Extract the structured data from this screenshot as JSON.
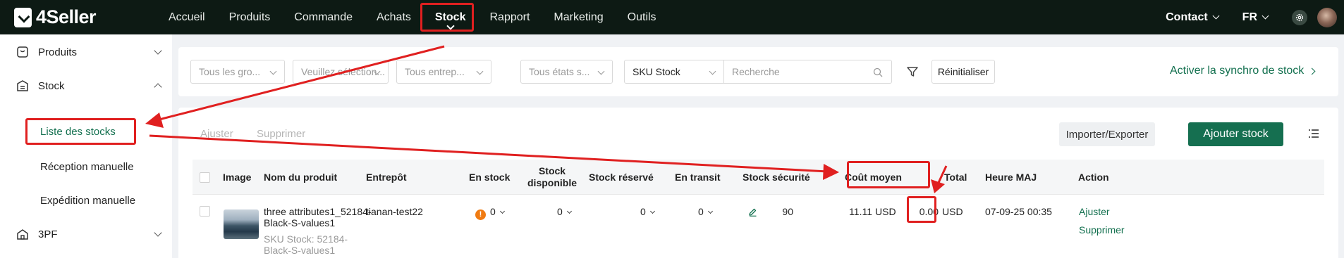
{
  "app": {
    "logo_text": "4Seller"
  },
  "nav": {
    "items": [
      {
        "label": "Accueil"
      },
      {
        "label": "Produits"
      },
      {
        "label": "Commande"
      },
      {
        "label": "Achats"
      },
      {
        "label": "Stock",
        "active": true
      },
      {
        "label": "Rapport"
      },
      {
        "label": "Marketing"
      },
      {
        "label": "Outils"
      }
    ],
    "contact_label": "Contact",
    "language_label": "FR",
    "settings_icon": "gear-icon"
  },
  "sidebar": {
    "groups": [
      {
        "label": "Produits",
        "icon": "product-box-icon",
        "expanded": false
      },
      {
        "label": "Stock",
        "icon": "stock-icon",
        "expanded": true
      },
      {
        "label": "3PF",
        "icon": "3pf-icon",
        "expanded": false
      }
    ],
    "stock_items": [
      {
        "label": "Liste des stocks",
        "active": true
      },
      {
        "label": "Réception manuelle"
      },
      {
        "label": "Expédition manuelle"
      }
    ]
  },
  "filters": {
    "group_placeholder": "Tous les gro...",
    "select_placeholder": "Veuillez sélection...",
    "warehouse_placeholder": "Tous entrep...",
    "state_placeholder": "Tous états s...",
    "search_type_value": "SKU Stock",
    "search_placeholder": "Recherche",
    "reset_label": "Réinitialiser",
    "sync_label": "Activer la synchro de stock"
  },
  "toolbar": {
    "adjust_label": "Ajuster",
    "delete_label": "Supprimer",
    "import_export_label": "Importer/Exporter",
    "add_stock_label": "Ajouter stock"
  },
  "table": {
    "headers": {
      "image": "Image",
      "product_name": "Nom du produit",
      "warehouse": "Entrepôt",
      "in_stock": "En stock",
      "available_1": "Stock",
      "available_2": "disponible",
      "reserved": "Stock réservé",
      "in_transit": "En transit",
      "safety_stock": "Stock sécurité",
      "avg_cost": "Coût moyen",
      "total": "Total",
      "updated": "Heure MAJ",
      "action": "Action"
    },
    "rows": [
      {
        "name_line1": "three attributes1_52184-",
        "name_line2": "Black-S-values1",
        "sku_line1": "SKU Stock: 52184-",
        "sku_line2": "Black-S-values1",
        "warehouse": "tianan-test22",
        "in_stock": "0",
        "available": "0",
        "reserved": "0",
        "in_transit": "0",
        "safety_stock": "90",
        "avg_cost": "11.11",
        "avg_cost_currency": "USD",
        "total": "0.00",
        "total_currency": "USD",
        "updated": "07-09-25 00:35",
        "action_adjust": "Ajuster",
        "action_delete": "Supprimer"
      }
    ]
  },
  "annotation_color": "#e02020",
  "accent_color": "#156f50"
}
